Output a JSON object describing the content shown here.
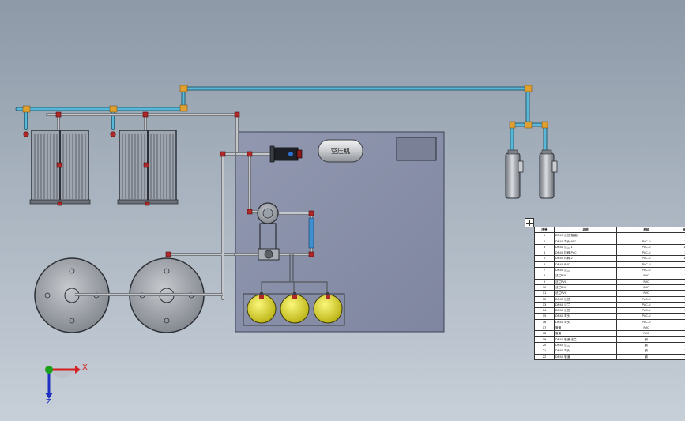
{
  "colors": {
    "background_top": "#8d99a7",
    "background_bottom": "#c7cfd8",
    "pipe_water": "#59b7d8",
    "pipe_grey": "#b7bcc2",
    "fitting": "#e0a030",
    "valve": "#b02828",
    "panel": "#8c92aa",
    "tank_yellow": "#e5e030",
    "axis_x": "#d42020",
    "axis_y": "#1aa01a",
    "axis_z": "#2030c0"
  },
  "diagram": {
    "compressor_label": "空压机",
    "axis_labels": {
      "x": "X",
      "z": "Z"
    }
  },
  "bom": {
    "icon": "table-move-icon",
    "headers": [
      "序号",
      "名称",
      "材料",
      "数量"
    ],
    "rows": [
      [
        "1",
        "DN40 法兰(管道)",
        "",
        "1"
      ],
      [
        "2",
        "DN40 弯头 90°",
        "PVC-U",
        "2"
      ],
      [
        "3",
        "DN40 法兰 1",
        "PVC-U",
        "12"
      ],
      [
        "4",
        "DN40 球阀 PVC",
        "PVC-U",
        "2"
      ],
      [
        "5",
        "DN40 球阀 2",
        "PVC-U",
        "14"
      ],
      [
        "6",
        "DN40 PVC",
        "PVC-U",
        "1"
      ],
      [
        "7",
        "DN40 法兰",
        "PVC-U",
        "1"
      ],
      [
        "8",
        "法兰PVC",
        "PVC",
        "1"
      ],
      [
        "9",
        "法兰PVC",
        "PVC",
        "1"
      ],
      [
        "10",
        "法兰PVC",
        "PVC",
        "1"
      ],
      [
        "11",
        "法兰PVC",
        "PVC",
        "1"
      ],
      [
        "12",
        "DN40 法兰",
        "PVC-U",
        "2"
      ],
      [
        "13",
        "DN40 法兰",
        "PVC-U",
        "2"
      ],
      [
        "14",
        "DN40 法兰",
        "PVC-U",
        "2"
      ],
      [
        "15",
        "DN40 弯头",
        "PVC-U",
        "2"
      ],
      [
        "16",
        "DN40 弯头",
        "PVC-U",
        "1"
      ],
      [
        "17",
        "管道",
        "PVC",
        "1"
      ],
      [
        "18",
        "管道",
        "PVC",
        "1"
      ],
      [
        "19",
        "DN40 管道 法兰",
        "钢",
        "2"
      ],
      [
        "20",
        "DN40 法兰",
        "钢",
        "2"
      ],
      [
        "21",
        "DN40 弯头",
        "钢",
        "2"
      ],
      [
        "22",
        "DN40 管道",
        "钢",
        "2"
      ]
    ]
  }
}
